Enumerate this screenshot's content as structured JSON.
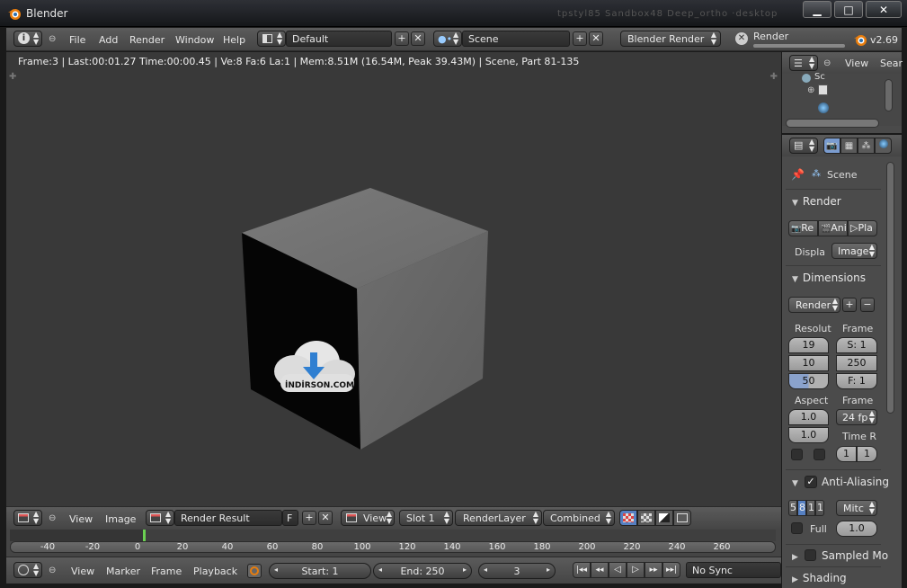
{
  "window": {
    "title": "Blender",
    "ghost_tabs": "tpstyl85  Sandbox48  Deep_ortho  ·desktop"
  },
  "menubar": {
    "menus": [
      "File",
      "Add",
      "Render",
      "Window",
      "Help"
    ],
    "layout": "Default",
    "scene": "Scene",
    "engine": "Blender Render",
    "render_label": "Render",
    "version": "v2.69"
  },
  "viewport": {
    "info": "Frame:3 | Last:00:01.27 Time:00:00.45 | Ve:8 Fa:6 La:1 | Mem:8.51M (16.54M, Peak 39.43M) | Scene, Part 81-135",
    "watermark": "İNDİRSON.COM"
  },
  "image_editor_header": {
    "view": "View",
    "image": "Image",
    "image_name": "Render Result",
    "fake_user": "F",
    "view_menu": "View",
    "slot": "Slot 1",
    "layer": "RenderLayer",
    "pass": "Combined"
  },
  "timeline": {
    "ticks": [
      "-40",
      "-20",
      "0",
      "20",
      "40",
      "60",
      "80",
      "100",
      "120",
      "140",
      "160",
      "180",
      "200",
      "220",
      "240",
      "260"
    ],
    "current_frame_fraction": 0.0117
  },
  "timeline_header": {
    "menus": [
      "View",
      "Marker",
      "Frame",
      "Playback"
    ],
    "start": "Start: 1",
    "end": "End: 250",
    "current": "3",
    "sync": "No Sync"
  },
  "outliner": {
    "view": "View",
    "search": "Sear",
    "item": "Sc"
  },
  "properties": {
    "context": "Scene",
    "render_panel": {
      "title": "Render",
      "render_btn": "Re",
      "anim_btn": "Ani",
      "play_btn": "Pla",
      "display_label": "Displa",
      "display_value": "Image"
    },
    "dimensions_panel": {
      "title": "Dimensions",
      "preset": "Render",
      "resolution_label": "Resolut",
      "res_x": "19",
      "res_y": "10",
      "res_pct": "50",
      "frame_label": "Frame",
      "frame_start": "S: 1",
      "frame_end": "250",
      "frame_step": "F: 1",
      "aspect_label": "Aspect",
      "aspect_x": "1.0",
      "aspect_y": "1.0",
      "framerate_label": "Frame",
      "framerate": "24 fp",
      "time_label": "Time R",
      "time_old": "1",
      "time_new": "1"
    },
    "aa_panel": {
      "title": "Anti-Aliasing",
      "samples": [
        "5",
        "8",
        "1",
        "1"
      ],
      "filter": "Mitc",
      "full": "Full",
      "filter_size": "1.0"
    },
    "sampled_panel": {
      "title": "Sampled Mo"
    },
    "shading_panel": {
      "title": "Shading"
    }
  }
}
